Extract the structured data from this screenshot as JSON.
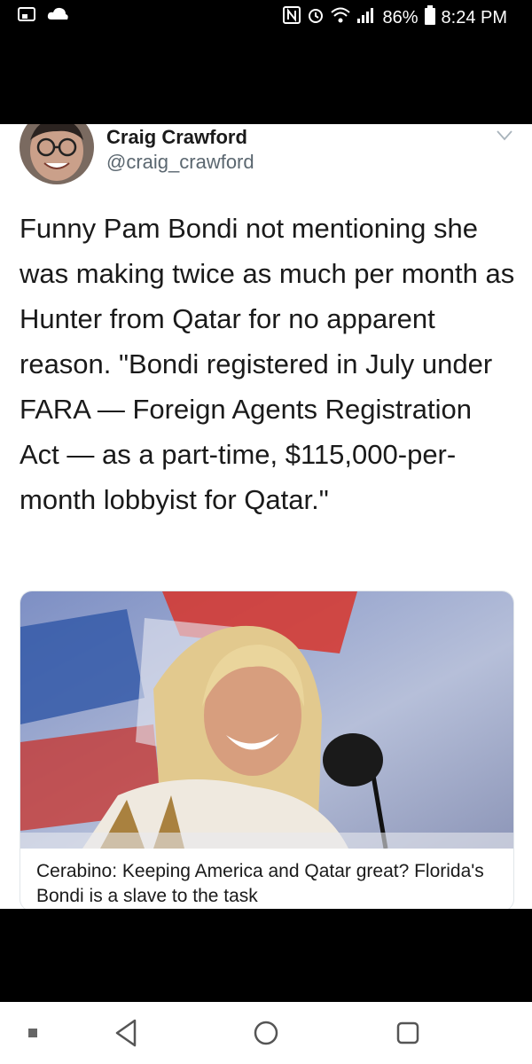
{
  "status_bar": {
    "battery": "86%",
    "time": "8:24 PM",
    "icons": [
      "screen-mirror-icon",
      "cloud-icon",
      "nfc-icon",
      "alarm-icon",
      "wifi-icon",
      "signal-icon",
      "battery-icon"
    ]
  },
  "tweet": {
    "author_name": "Craig Crawford",
    "author_handle": "@craig_crawford",
    "text": "Funny Pam Bondi not mentioning she was making twice as much per month as Hunter from Qatar for no apparent reason. \"Bondi registered in July under FARA — Foreign Agents Registration Act — as a part-time, $115,000-per-month lobbyist for Qatar.\"",
    "card": {
      "title": "Cerabino: Keeping America and Qatar great? Florida's Bondi is a slave to the task"
    }
  },
  "nav_bar": {
    "icons": [
      "recent-dot-icon",
      "back-icon",
      "home-icon",
      "overview-icon"
    ]
  },
  "colors": {
    "name": "#1a1a1a",
    "handle": "#5b6770",
    "background": "#ffffff",
    "card_border": "#e1e6ea"
  }
}
